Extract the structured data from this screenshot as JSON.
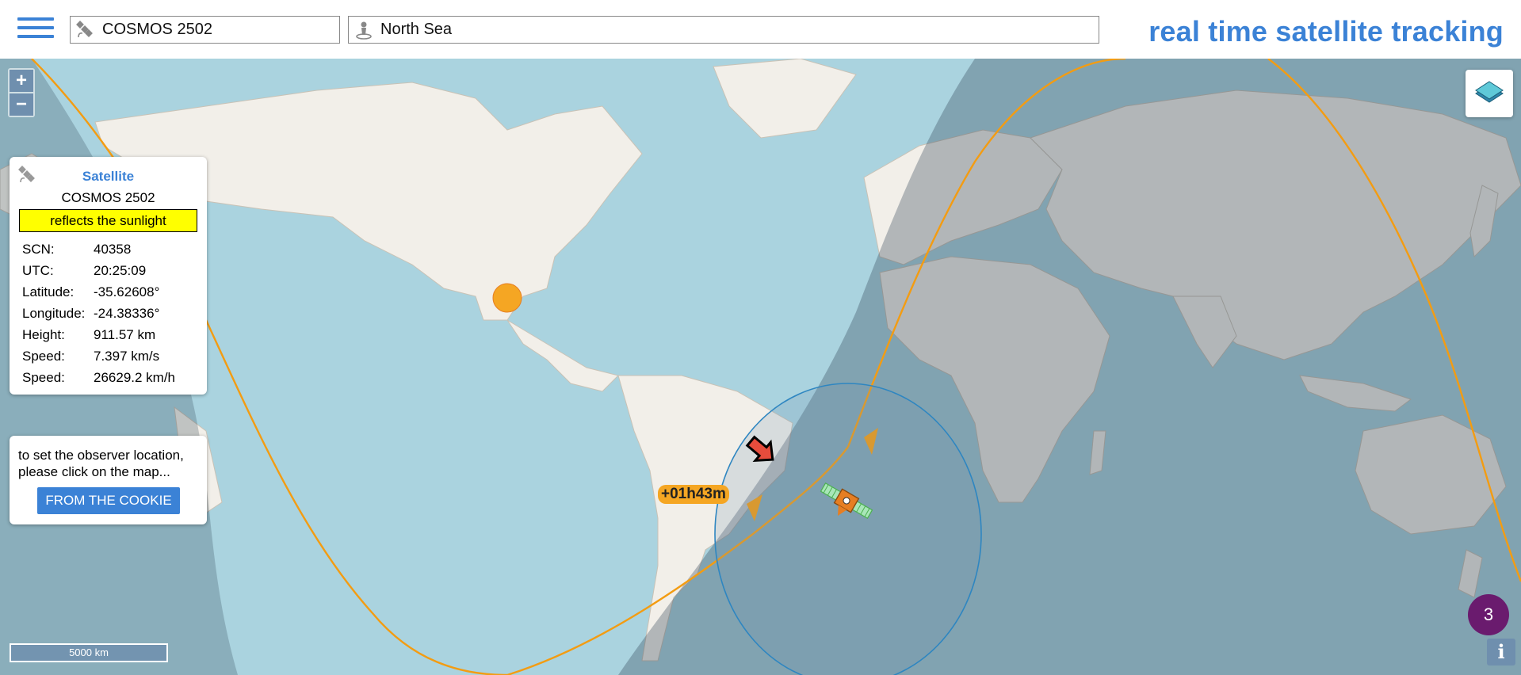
{
  "header": {
    "satellite_search_value": "COSMOS 2502",
    "location_search_value": "North Sea",
    "brand_title": "real time satellite tracking"
  },
  "map": {
    "zoom_in_label": "+",
    "zoom_out_label": "−",
    "track_time_label": "+01h43m",
    "scale_label": "5000 km",
    "notification_count": "3",
    "info_label": "i"
  },
  "satellite_panel": {
    "heading": "Satellite",
    "name": "COSMOS 2502",
    "status": "reflects the sunlight",
    "rows": [
      {
        "label": "SCN:",
        "value": "40358"
      },
      {
        "label": "UTC:",
        "value": "20:25:09"
      },
      {
        "label": "Latitude:",
        "value": "-35.62608°"
      },
      {
        "label": "Longitude:",
        "value": "-24.38336°"
      },
      {
        "label": "Height:",
        "value": "911.57 km"
      },
      {
        "label": "Speed:",
        "value": "7.397 km/s"
      },
      {
        "label": "Speed:",
        "value": "26629.2 km/h"
      }
    ]
  },
  "observer_panel": {
    "message": "to set the observer location, please click on the map...",
    "button_label": "FROM THE COOKIE"
  },
  "colors": {
    "accent": "#3b82d6",
    "track": "#f39c12",
    "ocean": "#aad3df",
    "land": "#f2efe9",
    "night": "#556b7a",
    "sun": "#f5a623",
    "status_highlight": "#ffff00",
    "badge": "#6a1b6e"
  }
}
